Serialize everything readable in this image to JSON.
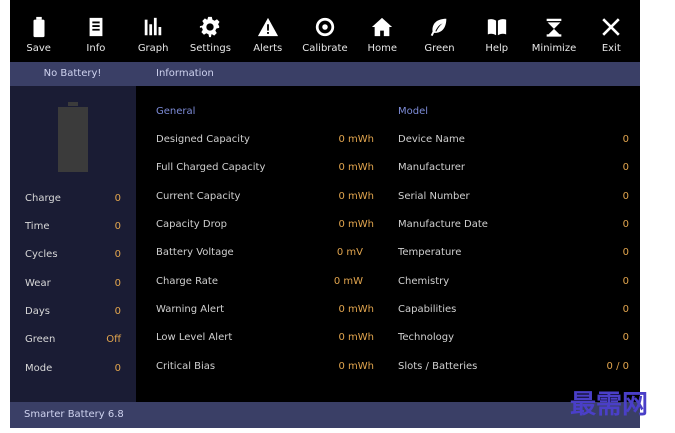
{
  "toolbar": [
    {
      "label": "Save",
      "icon": "save-icon"
    },
    {
      "label": "Info",
      "icon": "info-icon"
    },
    {
      "label": "Graph",
      "icon": "graph-icon"
    },
    {
      "label": "Settings",
      "icon": "gear-icon"
    },
    {
      "label": "Alerts",
      "icon": "alert-icon"
    },
    {
      "label": "Calibrate",
      "icon": "target-icon"
    },
    {
      "label": "Home",
      "icon": "home-icon"
    },
    {
      "label": "Green",
      "icon": "leaf-icon"
    },
    {
      "label": "Help",
      "icon": "book-icon"
    },
    {
      "label": "Minimize",
      "icon": "minimize-icon"
    },
    {
      "label": "Exit",
      "icon": "close-icon"
    }
  ],
  "header": {
    "status": "No Battery!",
    "section": "Information"
  },
  "sidebar": {
    "items": [
      {
        "label": "Charge",
        "value": "0"
      },
      {
        "label": "Time",
        "value": "0"
      },
      {
        "label": "Cycles",
        "value": "0"
      },
      {
        "label": "Wear",
        "value": "0"
      },
      {
        "label": "Days",
        "value": "0"
      },
      {
        "label": "Green",
        "value": "Off"
      },
      {
        "label": "Mode",
        "value": "0"
      }
    ]
  },
  "general": {
    "title": "General",
    "rows": [
      {
        "label": "Designed Capacity",
        "value": "0  mWh"
      },
      {
        "label": "Full Charged Capacity",
        "value": "0  mWh"
      },
      {
        "label": "Current Capacity",
        "value": "0  mWh"
      },
      {
        "label": "Capacity Drop",
        "value": "0  mWh"
      },
      {
        "label": "Battery Voltage",
        "value": "0  mV"
      },
      {
        "label": "Charge Rate",
        "value": "0  mW"
      },
      {
        "label": "Warning Alert",
        "value": "0  mWh"
      },
      {
        "label": "Low Level Alert",
        "value": "0  mWh"
      },
      {
        "label": "Critical Bias",
        "value": "0  mWh"
      }
    ]
  },
  "model": {
    "title": "Model",
    "rows": [
      {
        "label": "Device Name",
        "value": "0"
      },
      {
        "label": "Manufacturer",
        "value": "0"
      },
      {
        "label": "Serial Number",
        "value": "0"
      },
      {
        "label": "Manufacture Date",
        "value": "0"
      },
      {
        "label": "Temperature",
        "value": "0"
      },
      {
        "label": "Chemistry",
        "value": "0"
      },
      {
        "label": "Capabilities",
        "value": "0"
      },
      {
        "label": "Technology",
        "value": "0"
      },
      {
        "label": "Slots / Batteries",
        "value": "0 / 0"
      }
    ]
  },
  "footer": {
    "title": "Smarter Battery 6.8"
  },
  "watermark": {
    "text": "最需网"
  },
  "colors": {
    "accent": "#e2a54e",
    "section": "#7d8cd8",
    "bar": "#3a3f66",
    "sidebar": "#1a1c34"
  }
}
